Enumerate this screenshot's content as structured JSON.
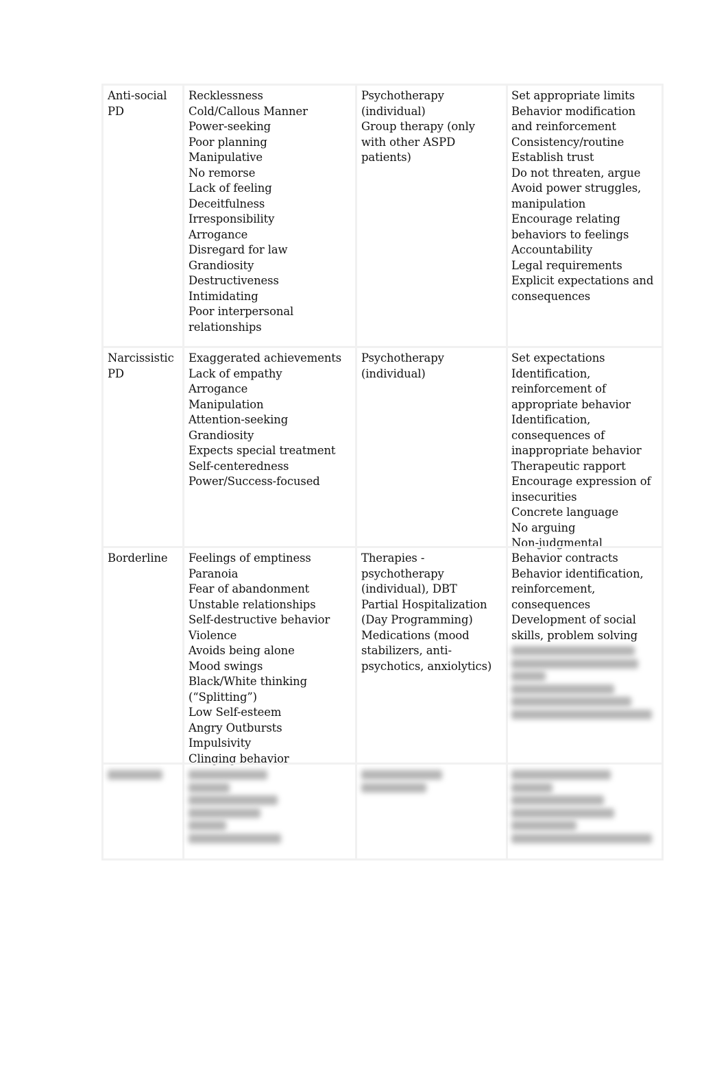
{
  "rows": [
    {
      "disorder": [
        "Anti-social",
        "PD"
      ],
      "symptoms": [
        "Recklessness",
        "Cold/Callous Manner",
        "Power-seeking",
        "Poor planning",
        "Manipulative",
        "No remorse",
        "Lack of feeling",
        "Deceitfulness",
        "Irresponsibility",
        "Arrogance",
        "Disregard for law",
        "Grandiosity",
        "Destructiveness",
        "Intimidating",
        "Poor interpersonal",
        "relationships"
      ],
      "treatment": [
        "Psychotherapy",
        "(individual)",
        "Group therapy (only",
        "with other ASPD",
        "patients)"
      ],
      "nursing": [
        "Set appropriate limits",
        "Behavior modification",
        "and reinforcement",
        "Consistency/routine",
        "Establish trust",
        "Do not threaten, argue",
        "Avoid power struggles,",
        "manipulation",
        "Encourage relating",
        "behaviors to feelings",
        "Accountability",
        "Legal requirements",
        "Explicit expectations and",
        "consequences"
      ]
    },
    {
      "disorder": [
        "Narcissistic",
        "PD"
      ],
      "symptoms": [
        "Exaggerated achievements",
        "Lack of empathy",
        "Arrogance",
        "Manipulation",
        "Attention-seeking",
        "Grandiosity",
        "Expects special treatment",
        "Self-centeredness",
        "Power/Success-focused"
      ],
      "treatment": [
        "Psychotherapy",
        "(individual)"
      ],
      "nursing": [
        "Set expectations",
        "Identification,",
        "reinforcement of",
        "appropriate behavior",
        "Identification,",
        "consequences of",
        "inappropriate behavior",
        "Therapeutic rapport",
        "Encourage expression of",
        "insecurities",
        "Concrete language",
        "No arguing",
        "Non-judgmental"
      ]
    },
    {
      "disorder": [
        "Borderline"
      ],
      "symptoms": [
        "Feelings of emptiness",
        "Paranoia",
        "Fear of abandonment",
        "Unstable relationships",
        "Self-destructive behavior",
        "Violence",
        "Avoids being alone",
        "Mood swings",
        "Black/White thinking",
        "(“Splitting”)",
        "Low Self-esteem",
        "Angry Outbursts",
        "Impulsivity",
        "Clinging behavior"
      ],
      "treatment": [
        "Therapies -",
        "psychotherapy",
        "(individual), DBT",
        "Partial Hospitalization",
        "(Day Programming)",
        "Medications (mood",
        "stabilizers, anti-",
        "psychotics, anxiolytics)"
      ],
      "nursing": [
        "Behavior contracts",
        "Behavior identification,",
        "reinforcement,",
        "consequences",
        "Development of social",
        "skills, problem solving"
      ]
    }
  ]
}
